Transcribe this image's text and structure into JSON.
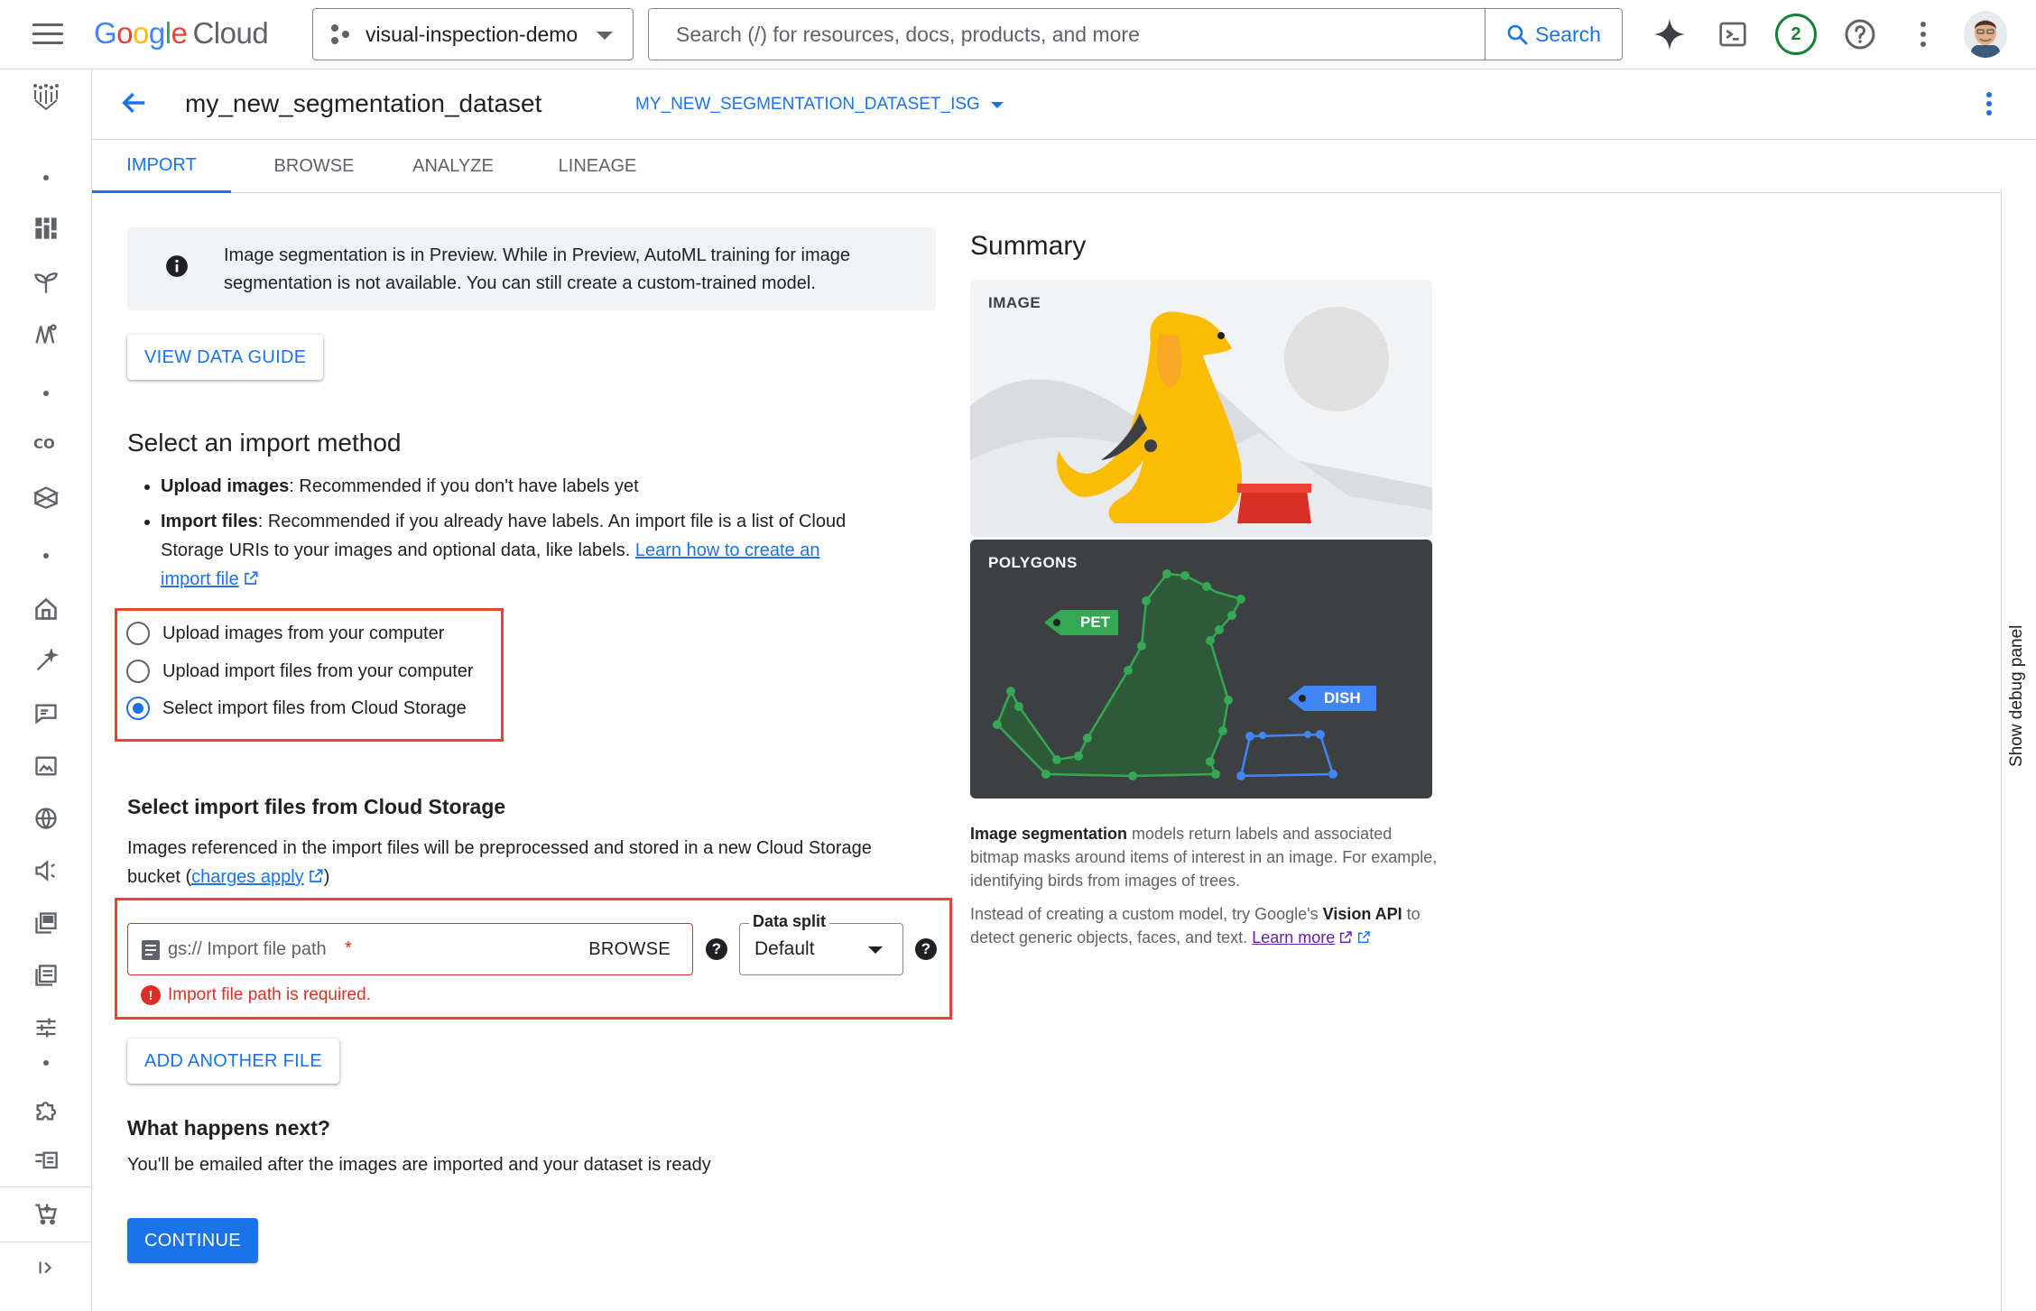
{
  "topbar": {
    "logo_google": "Google",
    "logo_cloud": "Cloud",
    "project_name": "visual-inspection-demo",
    "search_placeholder": "Search (/) for resources, docs, products, and more",
    "search_button": "Search",
    "notification_count": "2"
  },
  "header": {
    "dataset_title": "my_new_segmentation_dataset",
    "dataset_region": "MY_NEW_SEGMENTATION_DATASET_ISG"
  },
  "tabs": [
    {
      "label": "IMPORT",
      "active": true
    },
    {
      "label": "BROWSE",
      "active": false
    },
    {
      "label": "ANALYZE",
      "active": false
    },
    {
      "label": "LINEAGE",
      "active": false
    }
  ],
  "banner": {
    "text": "Image segmentation is in Preview. While in Preview, AutoML training for image segmentation is not available. You can still create a custom-trained model."
  },
  "view_data_guide": "VIEW DATA GUIDE",
  "import_method": {
    "title": "Select an import method",
    "upload_bold": "Upload images",
    "upload_rest": ": Recommended if you don't have labels yet",
    "files_bold": "Import files",
    "files_rest": ": Recommended if you already have labels. An import file is a list of Cloud Storage URIs to your images and optional data, like labels. ",
    "files_link": "Learn how to create an import file",
    "options": [
      {
        "label": "Upload images from your computer",
        "checked": false
      },
      {
        "label": "Upload import files from your computer",
        "checked": false
      },
      {
        "label": "Select import files from Cloud Storage",
        "checked": true
      }
    ]
  },
  "cloud_storage": {
    "title": "Select import files from Cloud Storage",
    "description": "Images referenced in the import files will be preprocessed and stored in a new Cloud Storage bucket (",
    "charges_link": "charges apply",
    "description_end": ")",
    "path_placeholder": "gs:// Import file path",
    "required_mark": "*",
    "browse": "BROWSE",
    "split_label": "Data split",
    "split_value": "Default",
    "error": "Import file path is required.",
    "add_another": "ADD ANOTHER FILE"
  },
  "next": {
    "title": "What happens next?",
    "text": "You'll be emailed after the images are imported and your dataset is ready",
    "continue": "CONTINUE"
  },
  "summary": {
    "title": "Summary",
    "image_tag": "IMAGE",
    "polygons_tag": "POLYGONS",
    "pet_label": "PET",
    "dish_label": "DISH",
    "desc1_bold": "Image segmentation",
    "desc1_rest": " models return labels and associated bitmap masks around items of interest in an image. For example, identifying birds from images of trees.",
    "desc2_start": "Instead of creating a custom model, try Google's ",
    "desc2_bold": "Vision API",
    "desc2_rest": " to detect generic objects, faces, and text. ",
    "desc2_link": "Learn more"
  },
  "debug_panel": "Show debug panel",
  "colors": {
    "accent": "#1a73e8",
    "error": "#d93025",
    "highlight_box": "#ea4335",
    "polygon_green": "#34a853",
    "polygon_blue": "#4285f4",
    "dog_yellow": "#fbbc04"
  },
  "icons": {
    "menu": "hamburger-icon",
    "search": "search-icon",
    "gemini": "sparkle-icon",
    "terminal": "terminal-icon",
    "help": "help-icon",
    "more": "more-vert-icon",
    "back": "arrow-back-icon",
    "info": "info-icon",
    "external": "open-in-new-icon",
    "error": "error-icon"
  }
}
